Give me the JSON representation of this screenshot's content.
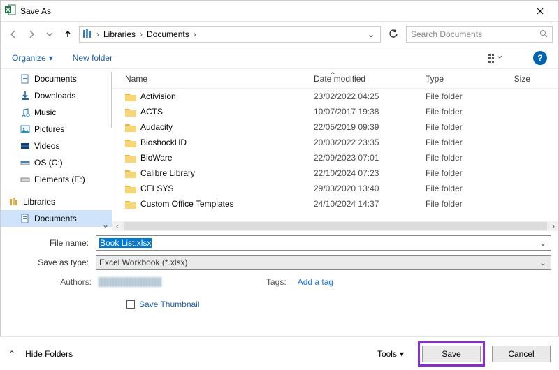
{
  "window": {
    "title": "Save As"
  },
  "nav": {
    "breadcrumb": {
      "icon": "library-icon",
      "seg1": "Libraries",
      "seg2": "Documents"
    },
    "search_placeholder": "Search Documents"
  },
  "toolbar": {
    "organize": "Organize",
    "new_folder": "New folder"
  },
  "tree": {
    "documents": "Documents",
    "downloads": "Downloads",
    "music": "Music",
    "pictures": "Pictures",
    "videos": "Videos",
    "os_c": "OS (C:)",
    "elements_e": "Elements (E:)",
    "libraries": "Libraries",
    "lib_documents": "Documents"
  },
  "columns": {
    "name": "Name",
    "date": "Date modified",
    "type": "Type",
    "size": "Size"
  },
  "files": [
    {
      "name": "Activision",
      "date": "23/02/2022 04:25",
      "type": "File folder"
    },
    {
      "name": "ACTS",
      "date": "10/07/2017 19:38",
      "type": "File folder"
    },
    {
      "name": "Audacity",
      "date": "22/05/2019 09:39",
      "type": "File folder"
    },
    {
      "name": "BioshockHD",
      "date": "20/03/2022 23:35",
      "type": "File folder"
    },
    {
      "name": "BioWare",
      "date": "22/09/2023 07:01",
      "type": "File folder"
    },
    {
      "name": "Calibre Library",
      "date": "22/10/2024 07:23",
      "type": "File folder"
    },
    {
      "name": "CELSYS",
      "date": "29/03/2020 13:40",
      "type": "File folder"
    },
    {
      "name": "Custom Office Templates",
      "date": "24/10/2024 14:37",
      "type": "File folder"
    }
  ],
  "form": {
    "file_name_label": "File name:",
    "file_name_value": "Book List.xlsx",
    "save_type_label": "Save as type:",
    "save_type_value": "Excel Workbook (*.xlsx)",
    "authors_label": "Authors:",
    "tags_label": "Tags:",
    "tags_hint": "Add a tag",
    "save_thumbnail": "Save Thumbnail"
  },
  "footer": {
    "hide_folders": "Hide Folders",
    "tools": "Tools",
    "save": "Save",
    "cancel": "Cancel"
  }
}
